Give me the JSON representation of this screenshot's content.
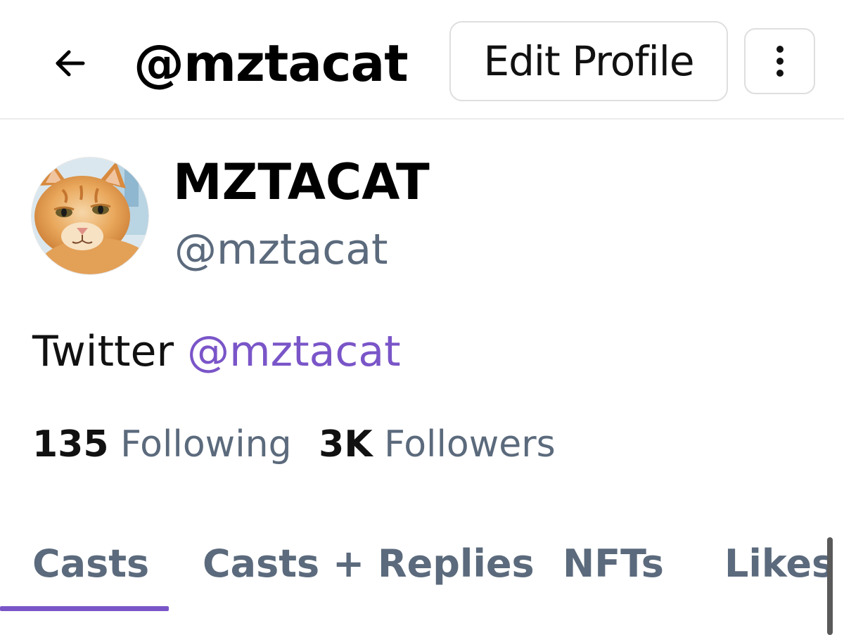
{
  "header": {
    "title": "@mztacat",
    "edit_profile_label": "Edit Profile"
  },
  "profile": {
    "display_name": "MZTACAT",
    "username": "@mztacat",
    "bio_text": "Twitter",
    "bio_mention": "@mztacat",
    "following_count": "135",
    "following_label": "Following",
    "followers_count": "3K",
    "followers_label": "Followers"
  },
  "tabs": [
    {
      "label": "Casts",
      "active": true
    },
    {
      "label": "Casts + Replies",
      "active": false
    },
    {
      "label": "NFTs",
      "active": false
    },
    {
      "label": "Likes",
      "active": false
    }
  ],
  "colors": {
    "accent": "#7a55c8",
    "secondary_text": "#5b6a7c",
    "border": "#dedede"
  },
  "icons": {
    "back": "arrow-left-icon",
    "more": "vertical-dots-icon"
  }
}
